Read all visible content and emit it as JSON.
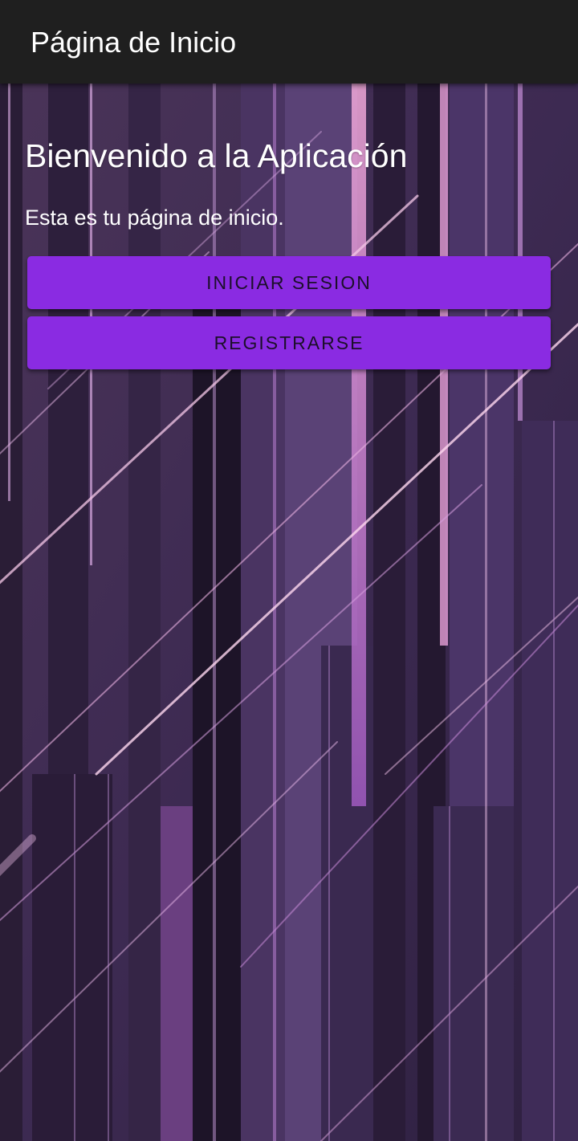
{
  "app_bar": {
    "title": "Página de Inicio"
  },
  "main": {
    "heading": "Bienvenido a la Aplicación",
    "subtitle": "Esta es tu página de inicio.",
    "buttons": {
      "login_label": "INICIAR SESION",
      "register_label": "REGISTRARSE"
    }
  },
  "colors": {
    "app_bar_background": "#1f1f1f",
    "button_background": "#8a2be2",
    "button_text": "#1c0f2a",
    "heading_text": "#ffffff",
    "background_base": "#3a2a4a"
  }
}
